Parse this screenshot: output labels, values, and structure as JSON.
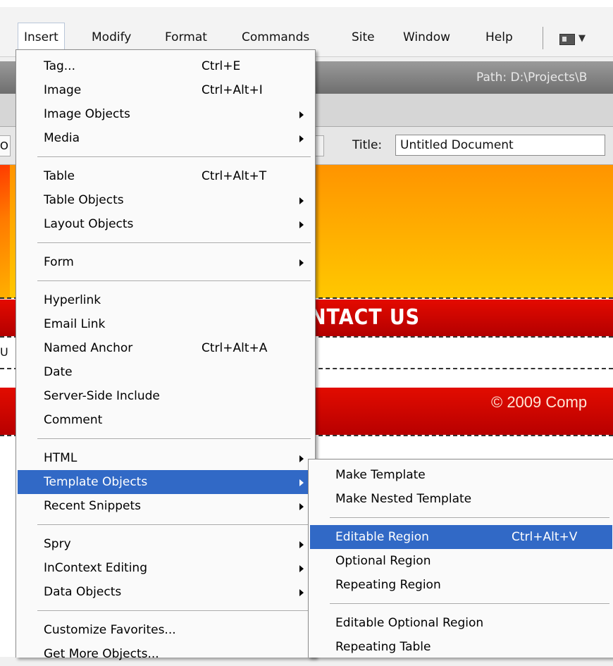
{
  "menubar": {
    "items": [
      "Insert",
      "Modify",
      "Format",
      "Commands",
      "Site",
      "Window",
      "Help"
    ]
  },
  "pathbar": {
    "label": "Path:  D:\\Projects\\B"
  },
  "docbar": {
    "stub": "O",
    "title_label": "Title:",
    "title_value": "Untitled Document"
  },
  "page": {
    "nav_text": "NTACT US",
    "content_stub": "U",
    "footer_text": "© 2009 Comp"
  },
  "insert_menu": {
    "groups": [
      [
        {
          "label": "Tag...",
          "shortcut": "Ctrl+E"
        },
        {
          "label": "Image",
          "shortcut": "Ctrl+Alt+I"
        },
        {
          "label": "Image Objects",
          "submenu": true
        },
        {
          "label": "Media",
          "submenu": true
        }
      ],
      [
        {
          "label": "Table",
          "shortcut": "Ctrl+Alt+T"
        },
        {
          "label": "Table Objects",
          "submenu": true
        },
        {
          "label": "Layout Objects",
          "submenu": true
        }
      ],
      [
        {
          "label": "Form",
          "submenu": true
        }
      ],
      [
        {
          "label": "Hyperlink"
        },
        {
          "label": "Email Link"
        },
        {
          "label": "Named Anchor",
          "shortcut": "Ctrl+Alt+A"
        },
        {
          "label": "Date"
        },
        {
          "label": "Server-Side Include"
        },
        {
          "label": "Comment"
        }
      ],
      [
        {
          "label": "HTML",
          "submenu": true
        },
        {
          "label": "Template Objects",
          "submenu": true,
          "highlighted": true
        },
        {
          "label": "Recent Snippets",
          "submenu": true
        }
      ],
      [
        {
          "label": "Spry",
          "submenu": true
        },
        {
          "label": "InContext Editing",
          "submenu": true
        },
        {
          "label": "Data Objects",
          "submenu": true
        }
      ],
      [
        {
          "label": "Customize Favorites..."
        },
        {
          "label": "Get More Objects..."
        }
      ]
    ]
  },
  "template_menu": {
    "groups": [
      [
        {
          "label": "Make Template"
        },
        {
          "label": "Make Nested Template"
        }
      ],
      [
        {
          "label": "Editable Region",
          "shortcut": "Ctrl+Alt+V",
          "highlighted": true
        },
        {
          "label": "Optional Region"
        },
        {
          "label": "Repeating Region"
        }
      ],
      [
        {
          "label": "Editable Optional Region"
        },
        {
          "label": "Repeating Table"
        }
      ]
    ]
  },
  "colors": {
    "highlight": "#3169c6",
    "banner_top": "#ff9400",
    "banner_bottom": "#ffc800",
    "nav_red": "#d00000"
  }
}
